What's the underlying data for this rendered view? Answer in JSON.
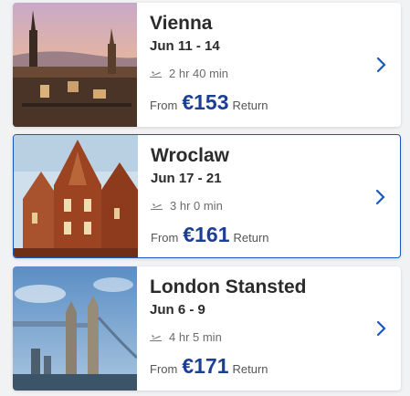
{
  "accent": "#1b57c3",
  "price_color": "#1b3f94",
  "destinations": [
    {
      "city": "Vienna",
      "dates": "Jun 11 - 14",
      "duration": "2 hr 40 min",
      "from_label": "From",
      "price": "€153",
      "return_label": "Return",
      "selected": false
    },
    {
      "city": "Wroclaw",
      "dates": "Jun 17 - 21",
      "duration": "3 hr 0 min",
      "from_label": "From",
      "price": "€161",
      "return_label": "Return",
      "selected": true
    },
    {
      "city": "London Stansted",
      "dates": "Jun 6 - 9",
      "duration": "4 hr 5 min",
      "from_label": "From",
      "price": "€171",
      "return_label": "Return",
      "selected": false
    }
  ],
  "icons": {
    "plane": "plane-icon",
    "chevron": "chevron-right-icon"
  }
}
